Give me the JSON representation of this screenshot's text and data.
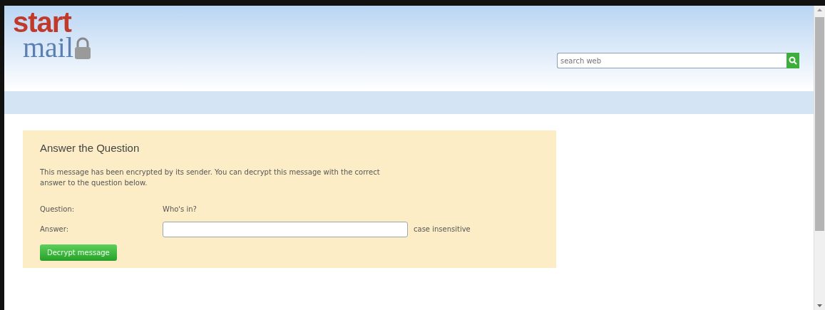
{
  "logo": {
    "word_1": "start",
    "word_2": "mail"
  },
  "search": {
    "placeholder": "search web"
  },
  "card": {
    "title": "Answer the Question",
    "message": "This message has been encrypted by its sender. You can decrypt this message with the correct answer to the question below.",
    "question_label": "Question:",
    "question": "Who's in?",
    "answer_label": "Answer:",
    "answer_hint": "case insensitive",
    "button": "Decrypt message"
  }
}
